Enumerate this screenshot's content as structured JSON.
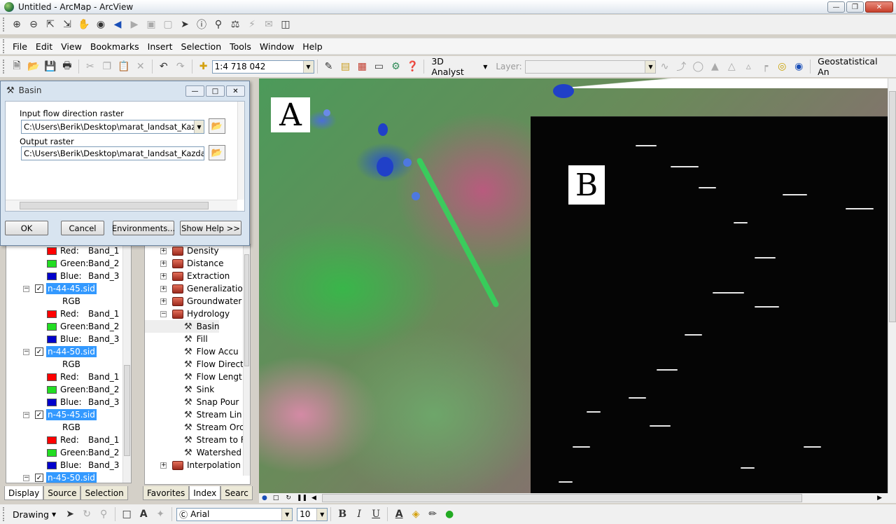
{
  "window": {
    "title": "Untitled - ArcMap - ArcView"
  },
  "menu": [
    "File",
    "Edit",
    "View",
    "Bookmarks",
    "Insert",
    "Selection",
    "Tools",
    "Window",
    "Help"
  ],
  "standard_toolbar": {
    "scale": "1:4 718 042",
    "analyst": "3D Analyst",
    "layer_label": "Layer:",
    "geostat": "Geostatistical An"
  },
  "dialog": {
    "title": "Basin",
    "input_label": "Input flow direction raster",
    "input_value": "C:\\Users\\Berik\\Desktop\\marat_landsat_Kazdata",
    "output_label": "Output raster",
    "output_value": "C:\\Users\\Berik\\Desktop\\marat_landsat_Kazdata\\Basin",
    "ok": "OK",
    "cancel": "Cancel",
    "environments": "Environments...",
    "help": "Show Help >>"
  },
  "toc": {
    "rows": [
      {
        "type": "band",
        "label": "Red:",
        "value": "Band_1",
        "color": "#ff0000"
      },
      {
        "type": "band",
        "label": "Green:",
        "value": "Band_2",
        "color": "#22dd22"
      },
      {
        "type": "band",
        "label": "Blue:",
        "value": "Band_3",
        "color": "#0000cc"
      },
      {
        "type": "layer",
        "label": "n-44-45.sid"
      },
      {
        "type": "rgb",
        "label": "RGB"
      },
      {
        "type": "band",
        "label": "Red:",
        "value": "Band_1",
        "color": "#ff0000"
      },
      {
        "type": "band",
        "label": "Green:",
        "value": "Band_2",
        "color": "#22dd22"
      },
      {
        "type": "band",
        "label": "Blue:",
        "value": "Band_3",
        "color": "#0000cc"
      },
      {
        "type": "layer",
        "label": "n-44-50.sid"
      },
      {
        "type": "rgb",
        "label": "RGB"
      },
      {
        "type": "band",
        "label": "Red:",
        "value": "Band_1",
        "color": "#ff0000"
      },
      {
        "type": "band",
        "label": "Green:",
        "value": "Band_2",
        "color": "#22dd22"
      },
      {
        "type": "band",
        "label": "Blue:",
        "value": "Band_3",
        "color": "#0000cc"
      },
      {
        "type": "layer",
        "label": "n-45-45.sid"
      },
      {
        "type": "rgb",
        "label": "RGB"
      },
      {
        "type": "band",
        "label": "Red:",
        "value": "Band_1",
        "color": "#ff0000"
      },
      {
        "type": "band",
        "label": "Green:",
        "value": "Band_2",
        "color": "#22dd22"
      },
      {
        "type": "band",
        "label": "Blue:",
        "value": "Band_3",
        "color": "#0000cc"
      },
      {
        "type": "layer",
        "label": "n-45-50.sid"
      }
    ],
    "tabs": [
      "Display",
      "Source",
      "Selection"
    ]
  },
  "toolbox": {
    "rows": [
      {
        "type": "toolset",
        "label": "Density"
      },
      {
        "type": "toolset",
        "label": "Distance"
      },
      {
        "type": "toolset",
        "label": "Extraction"
      },
      {
        "type": "toolset",
        "label": "Generalization"
      },
      {
        "type": "toolset",
        "label": "Groundwater"
      },
      {
        "type": "toolset-open",
        "label": "Hydrology"
      },
      {
        "type": "tool",
        "label": "Basin"
      },
      {
        "type": "tool",
        "label": "Fill"
      },
      {
        "type": "tool",
        "label": "Flow Accu"
      },
      {
        "type": "tool",
        "label": "Flow Direct"
      },
      {
        "type": "tool",
        "label": "Flow Lengt"
      },
      {
        "type": "tool",
        "label": "Sink"
      },
      {
        "type": "tool",
        "label": "Snap Pour"
      },
      {
        "type": "tool",
        "label": "Stream Lin"
      },
      {
        "type": "tool",
        "label": "Stream Orc"
      },
      {
        "type": "tool",
        "label": "Stream to F"
      },
      {
        "type": "tool",
        "label": "Watershed"
      },
      {
        "type": "toolset",
        "label": "Interpolation"
      }
    ],
    "tabs": [
      "Favorites",
      "Index",
      "Searc"
    ]
  },
  "map": {
    "label_a": "A",
    "label_b": "B"
  },
  "drawing_toolbar": {
    "label": "Drawing",
    "font": "Arial",
    "size": "10"
  }
}
